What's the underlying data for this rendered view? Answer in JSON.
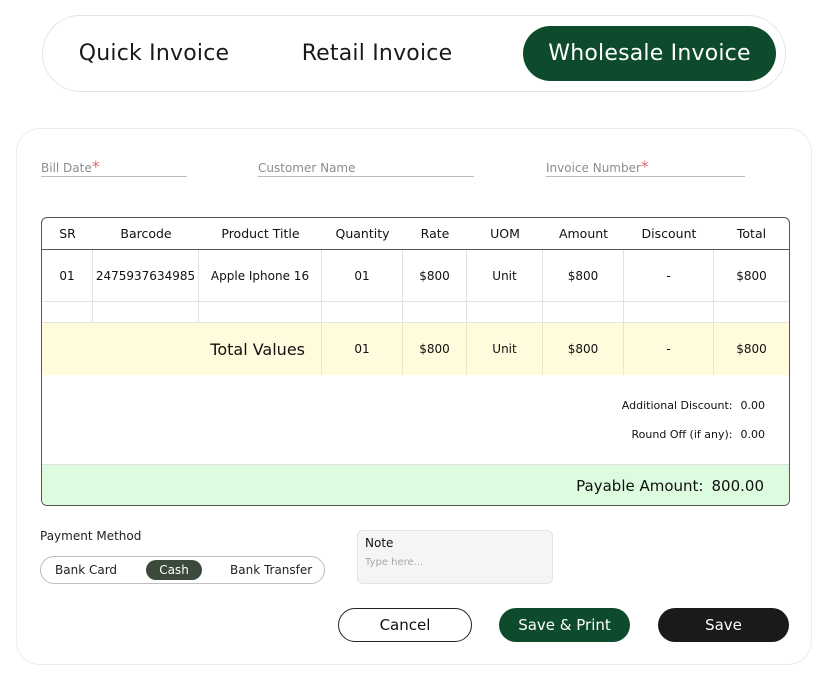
{
  "tabs": {
    "quick": "Quick Invoice",
    "retail": "Retail Invoice",
    "wholesale": "Wholesale Invoice"
  },
  "form": {
    "bill_date": "Bill Date",
    "customer_name": "Customer Name",
    "invoice_number": "Invoice Number",
    "required_mark": "*"
  },
  "table": {
    "headers": [
      "SR",
      "Barcode",
      "Product Title",
      "Quantity",
      "Rate",
      "UOM",
      "Amount",
      "Discount",
      "Total"
    ],
    "rows": [
      [
        "01",
        "2475937634985",
        "Apple Iphone 16",
        "01",
        "$800",
        "Unit",
        "$800",
        "-",
        "$800"
      ]
    ],
    "totals": {
      "label": "Total Values",
      "quantity": "01",
      "rate": "$800",
      "uom": "Unit",
      "amount": "$800",
      "discount": "-",
      "total": "$800"
    },
    "additional_discount": {
      "label": "Additional Discount:",
      "value": "0.00"
    },
    "round_off": {
      "label": "Round Off (if any):",
      "value": "0.00"
    },
    "payable": {
      "label": "Payable Amount:",
      "value": "800.00"
    }
  },
  "payment": {
    "label": "Payment Method",
    "options": [
      "Bank Card",
      "Cash",
      "Bank Transfer"
    ],
    "selected": "Cash"
  },
  "note": {
    "label": "Note",
    "placeholder": "Type here..."
  },
  "actions": {
    "cancel": "Cancel",
    "save_print": "Save & Print",
    "save": "Save"
  },
  "colors": {
    "brand_green": "#0e4b2c",
    "totals_row": "#fffbdc",
    "payable_row": "#dcfbdf",
    "save_button": "#1a1a1a"
  }
}
